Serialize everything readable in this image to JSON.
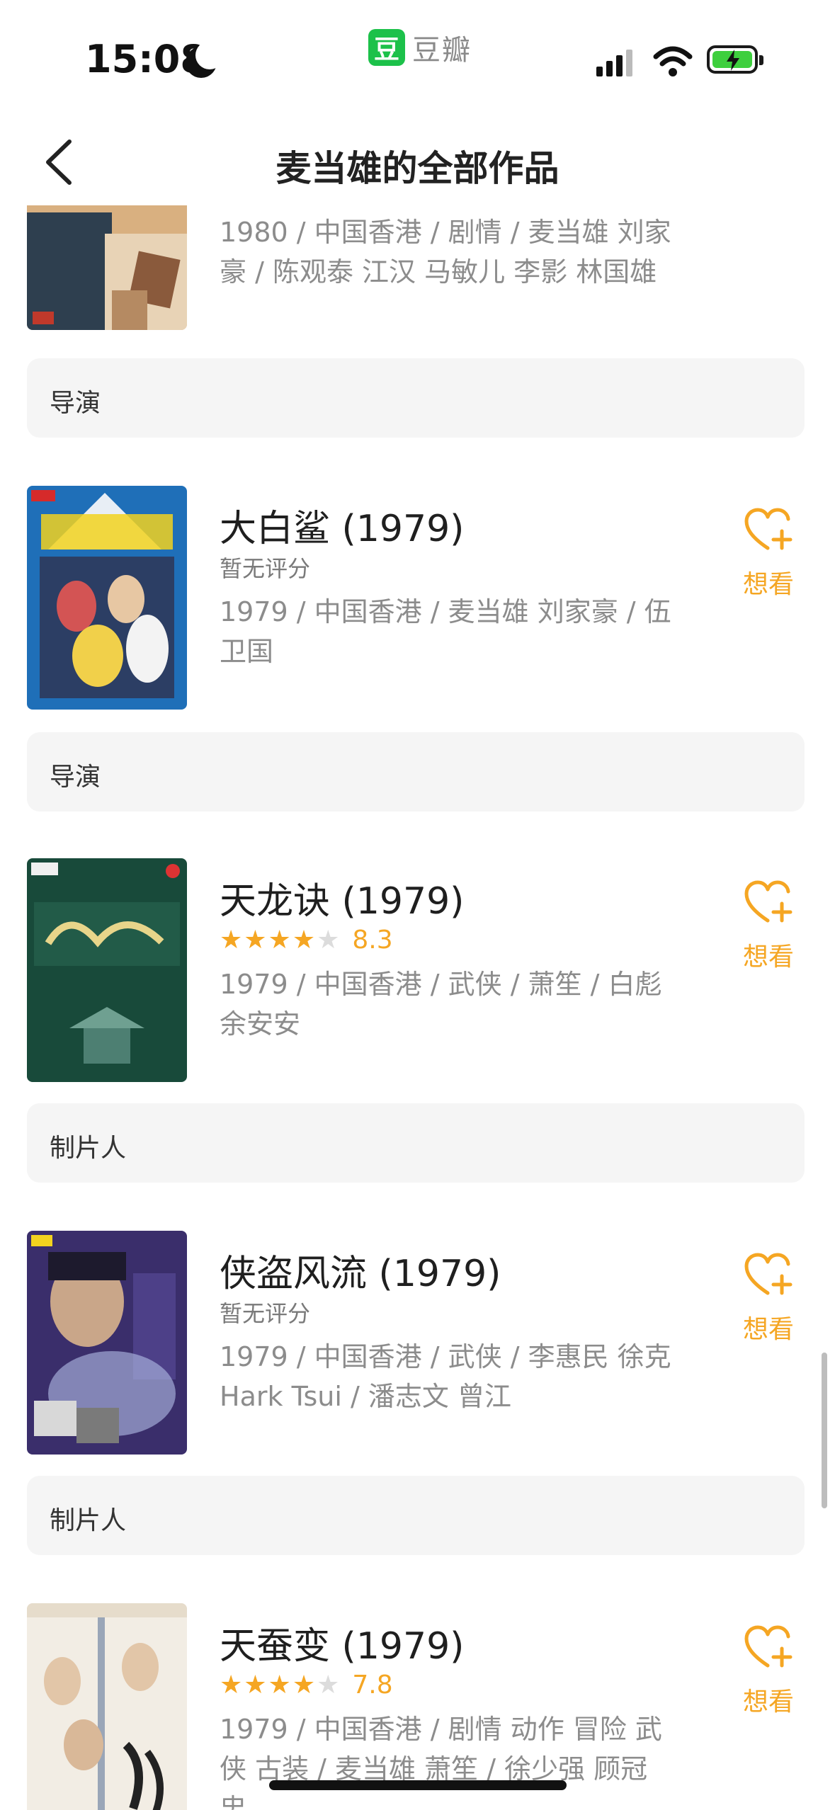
{
  "status_bar": {
    "time": "15:08",
    "brand_logo_char": "豆",
    "brand_name": "豆瓣"
  },
  "nav": {
    "title": "麦当雄的全部作品",
    "back_icon": "chevron-left-icon"
  },
  "colors": {
    "accent": "#f5a623",
    "brand": "#1cc14a",
    "section_bg": "#f5f5f5",
    "meta_text": "#8c8c8c"
  },
  "items": [
    {
      "title": "",
      "rating": "",
      "meta": "1980 / 中国香港 / 剧情 / 麦当雄 刘家豪 / 陈观泰 江汉 马敏儿 李影 林国雄",
      "wish_label": ""
    },
    {
      "title": "大白鲨 (1979)",
      "rating": "暂无评分",
      "meta": "1979 / 中国香港 / 麦当雄 刘家豪 / 伍卫国",
      "wish_label": "想看"
    },
    {
      "title": "天龙诀 (1979)",
      "rating": "8.3",
      "stars": 4,
      "meta": "1979 / 中国香港 / 武侠 / 萧笙 / 白彪 余安安",
      "wish_label": "想看"
    },
    {
      "title": "侠盗风流 (1979)",
      "rating": "暂无评分",
      "meta": "1979 / 中国香港 / 武侠 / 李惠民 徐克 Hark Tsui / 潘志文 曾江",
      "wish_label": "想看"
    },
    {
      "title": "天蚕变 (1979)",
      "rating": "7.8",
      "stars": 4,
      "meta": "1979 / 中国香港 / 剧情 动作 冒险 武侠 古装 / 麦当雄 萧笙 / 徐少强 顾冠忠",
      "wish_label": "想看"
    }
  ],
  "sections": [
    "导演",
    "导演",
    "制片人",
    "制片人"
  ]
}
